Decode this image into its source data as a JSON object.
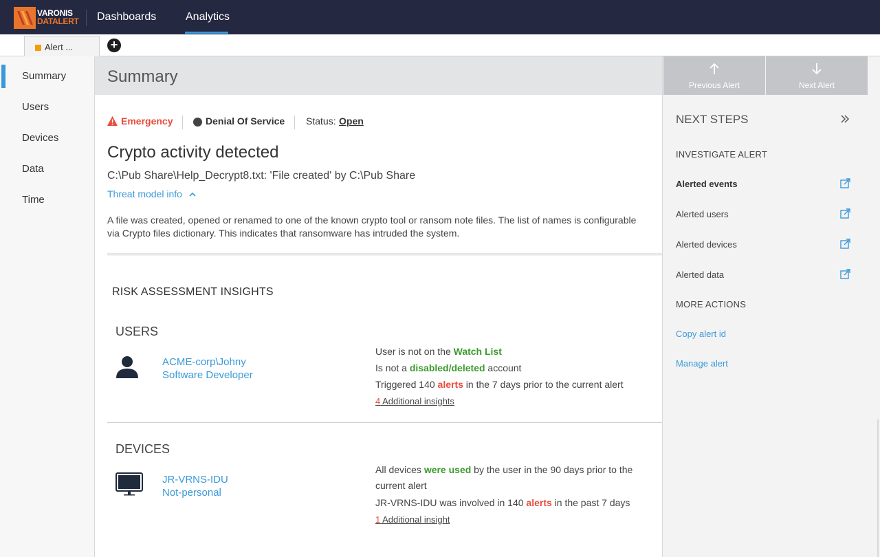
{
  "app": {
    "brand_line1": "VARONIS",
    "brand_line2": "DATALERT",
    "nav": {
      "dashboards": "Dashboards",
      "analytics": "Analytics"
    },
    "accent_color": "#3a9ad9",
    "brand_color": "#e8752a"
  },
  "tabs": [
    {
      "label": "Alert ..."
    }
  ],
  "add_tab_icon": "plus-circle-icon",
  "sidenav": {
    "items": [
      {
        "label": "Summary",
        "active": true
      },
      {
        "label": "Users"
      },
      {
        "label": "Devices"
      },
      {
        "label": "Data"
      },
      {
        "label": "Time"
      }
    ]
  },
  "summary": {
    "header": "Summary",
    "severity": "Emergency",
    "threat_type": "Denial Of Service",
    "status_label": "Status:",
    "status_value": "Open",
    "alert_title": "Crypto activity detected",
    "alert_desc": "C:\\Pub Share\\Help_Decrypt8.txt: 'File created' by C:\\Pub Share",
    "threat_model_link": "Threat model info",
    "threat_model_text": "A file was created, opened or renamed to one of the known crypto tool or ransom note files. The list of names is configurable via Crypto files dictionary. This indicates that ransomware has intruded the system."
  },
  "risk": {
    "title": "RISK ASSESSMENT INSIGHTS",
    "users": {
      "section_title": "USERS",
      "name": "ACME-corp\\Johny",
      "role": "Software Developer",
      "insight1_pre": "User is not on the ",
      "insight1_hl": "Watch List",
      "insight2_pre": "Is not a ",
      "insight2_hl": "disabled/deleted",
      "insight2_post": " account",
      "insight3_pre": "Triggered 140 ",
      "insight3_hl": "alerts",
      "insight3_post": " in the 7 days prior to the current alert",
      "additional_num": "4",
      "additional_text": " Additional insights"
    },
    "devices": {
      "section_title": "DEVICES",
      "name": "JR-VRNS-IDU",
      "type": "Not-personal",
      "insight1_pre": "All devices ",
      "insight1_hl": "were used",
      "insight1_post": " by the user in the 90 days prior to the",
      "insight1_line2": "current alert",
      "insight2_pre": "JR-VRNS-IDU was involved in 140 ",
      "insight2_hl": "alerts",
      "insight2_post": " in the past 7 days",
      "additional_num": "1",
      "additional_text": " Additional insight"
    }
  },
  "next_steps": {
    "prev_label": "Previous Alert",
    "next_label": "Next Alert",
    "title": "NEXT STEPS",
    "investigate_label": "INVESTIGATE ALERT",
    "items": [
      {
        "label": "Alerted events"
      },
      {
        "label": "Alerted users"
      },
      {
        "label": "Alerted devices"
      },
      {
        "label": "Alerted data"
      }
    ],
    "more_actions_label": "MORE ACTIONS",
    "actions": [
      {
        "label": "Copy alert id"
      },
      {
        "label": "Manage alert"
      }
    ]
  }
}
